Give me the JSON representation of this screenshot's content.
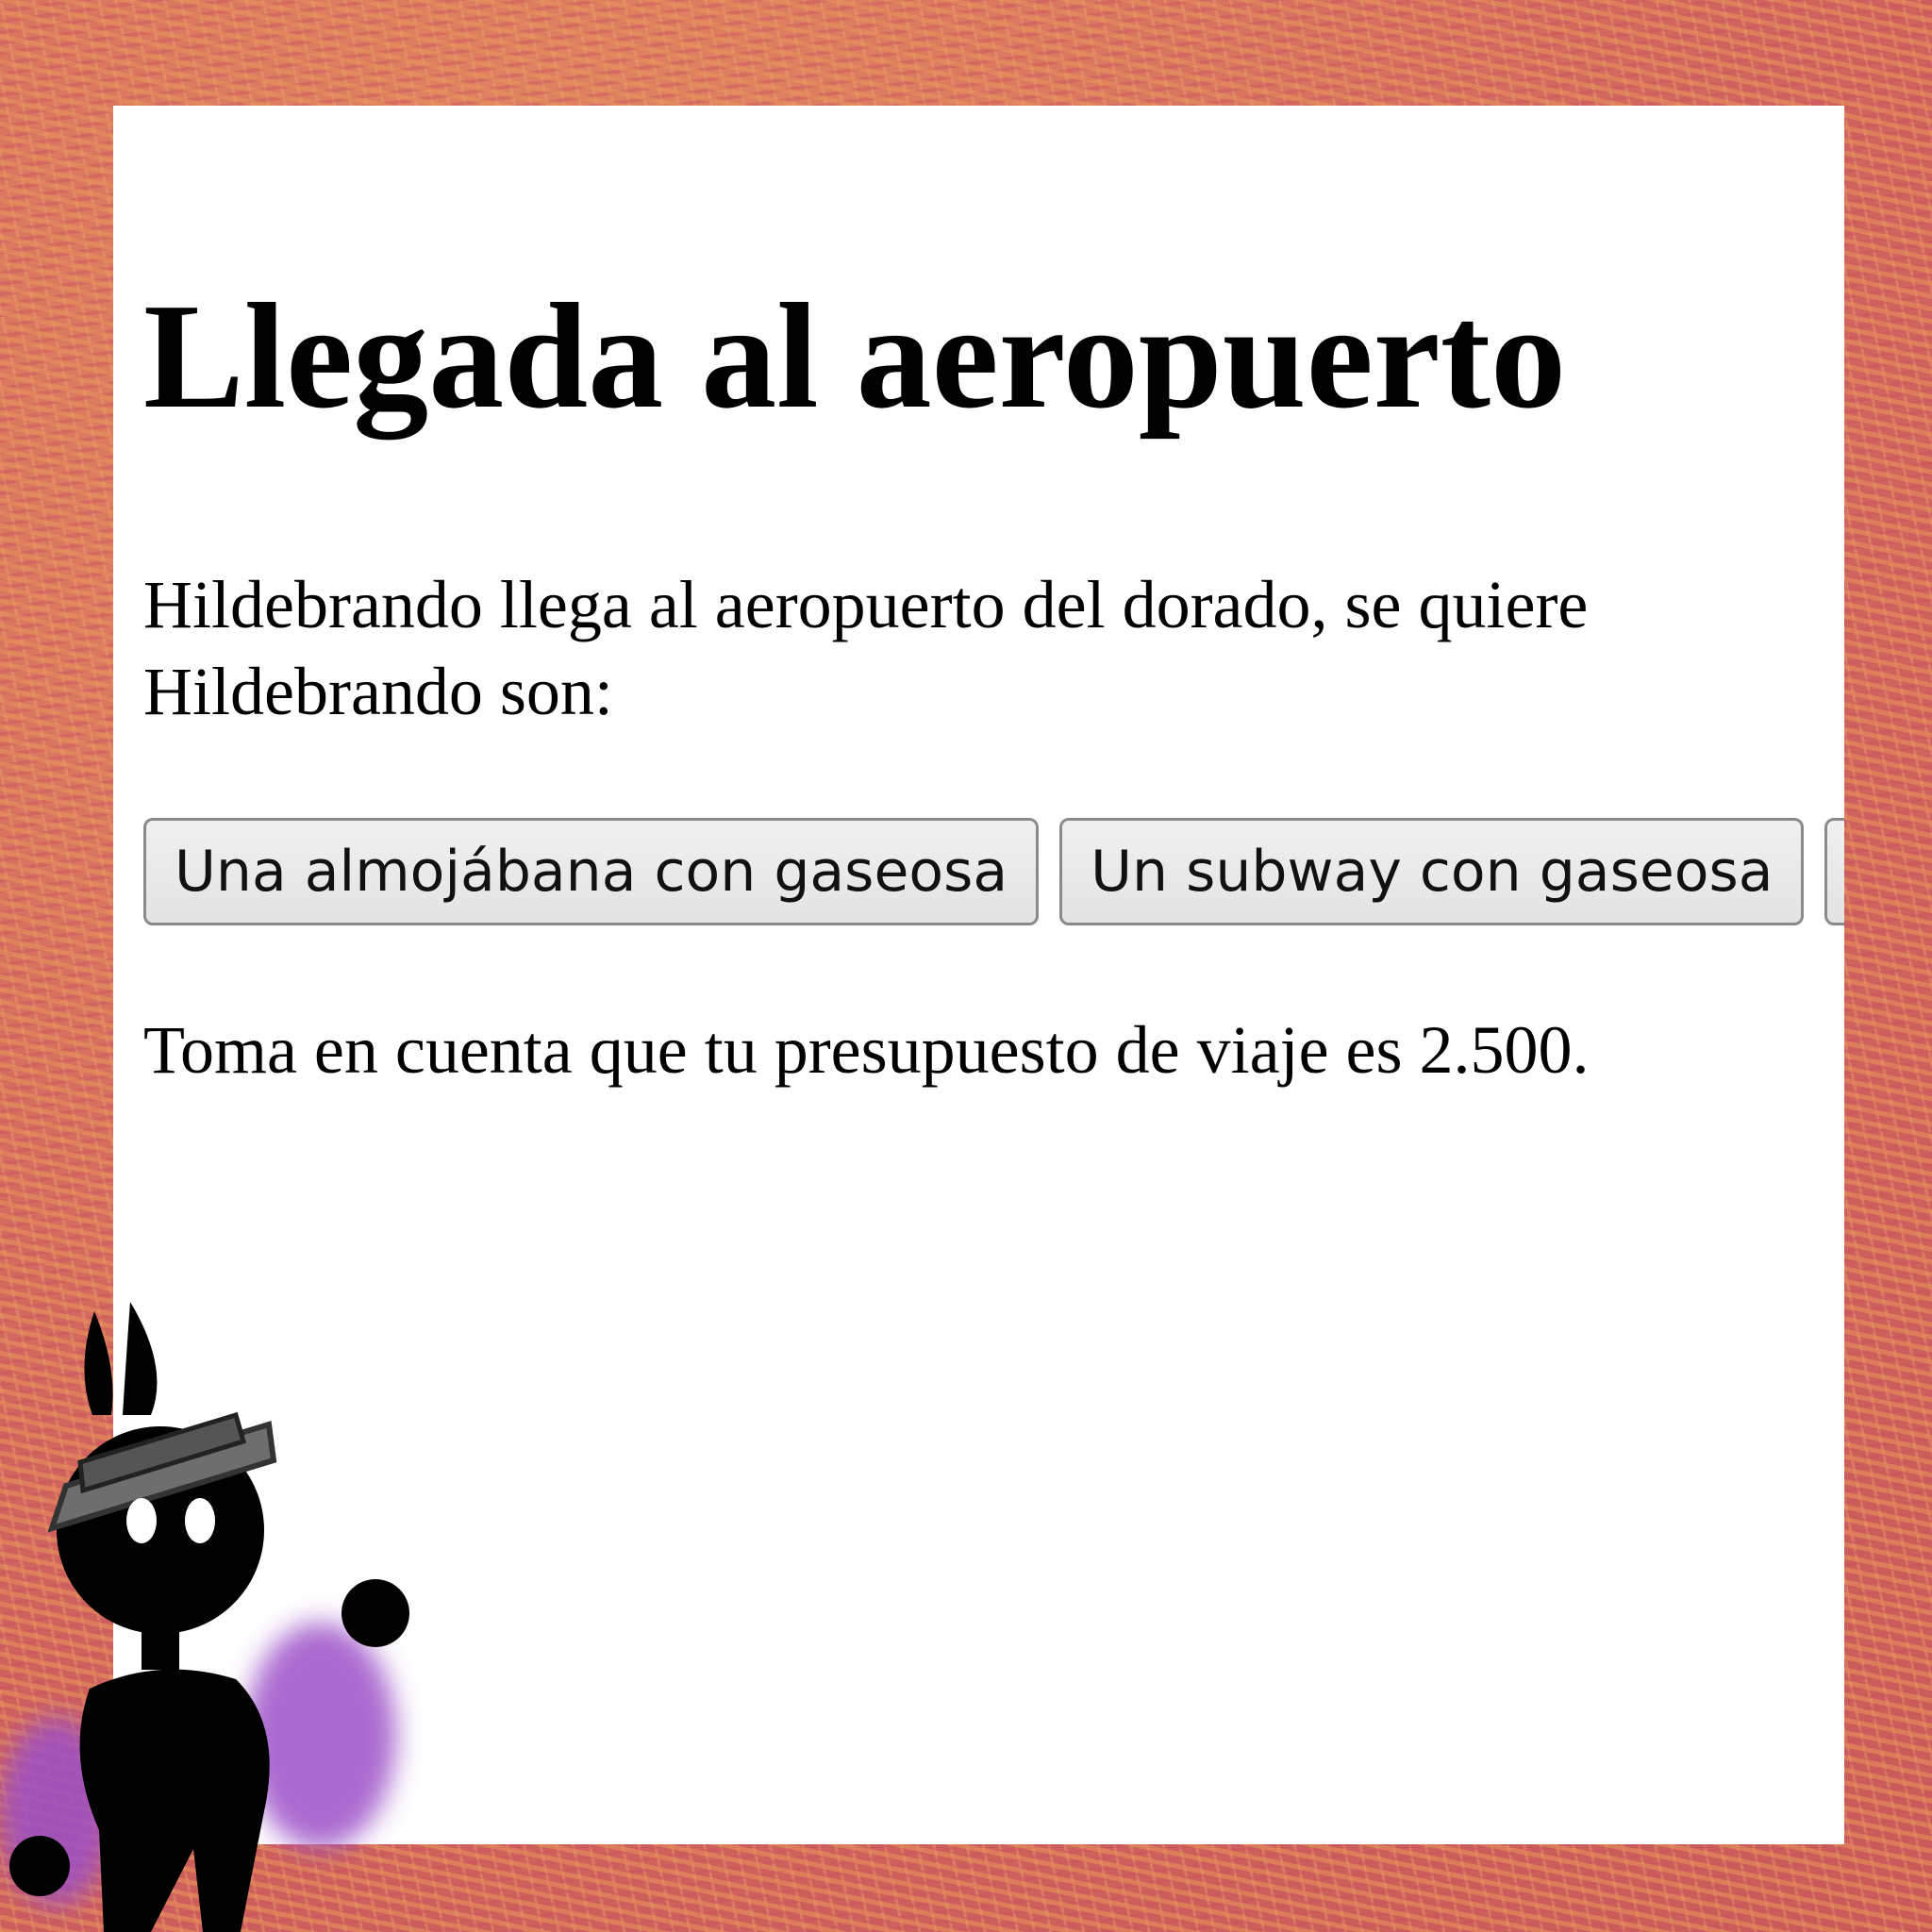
{
  "page": {
    "title": "Llegada al aeropuerto",
    "intro_line1": "Hildebrando llega al aeropuerto del dorado, se quiere",
    "intro_line2": "Hildebrando son:",
    "options": [
      {
        "label": "Una almojábana con gaseosa"
      },
      {
        "label": "Un subway con gaseosa"
      },
      {
        "label": ""
      }
    ],
    "budget_text": "Toma en cuenta que tu presupuesto de viaje es 2.500."
  },
  "decoration": {
    "character": "cartoon-character-icon",
    "frame": "painted-frame"
  },
  "colors": {
    "frame": "#d9705c",
    "page": "#ffffff",
    "character": "#000000",
    "aura": "#9b4fc7"
  }
}
